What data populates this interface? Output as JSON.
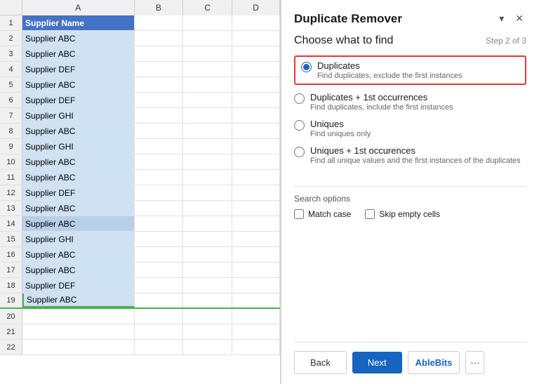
{
  "spreadsheet": {
    "columns": [
      "A",
      "B",
      "C",
      "D"
    ],
    "header_cell": "Supplier Name",
    "rows": [
      {
        "num": 1,
        "a": "Supplier Name",
        "is_header": true
      },
      {
        "num": 2,
        "a": "Supplier ABC",
        "selected": true
      },
      {
        "num": 3,
        "a": "Supplier ABC",
        "selected": true
      },
      {
        "num": 4,
        "a": "Supplier DEF",
        "selected": true
      },
      {
        "num": 5,
        "a": "Supplier ABC",
        "selected": true
      },
      {
        "num": 6,
        "a": "Supplier DEF",
        "selected": true
      },
      {
        "num": 7,
        "a": "Supplier GHI",
        "selected": true
      },
      {
        "num": 8,
        "a": "Supplier ABC",
        "selected": true
      },
      {
        "num": 9,
        "a": "Supplier GHI",
        "selected": true
      },
      {
        "num": 10,
        "a": "Supplier ABC",
        "selected": true
      },
      {
        "num": 11,
        "a": "Supplier ABC",
        "selected": true
      },
      {
        "num": 12,
        "a": "Supplier DEF",
        "selected": true
      },
      {
        "num": 13,
        "a": "Supplier ABC",
        "selected": true
      },
      {
        "num": 14,
        "a": "Supplier ABC",
        "selected": true,
        "alt": true
      },
      {
        "num": 15,
        "a": "Supplier GHI",
        "selected": true
      },
      {
        "num": 16,
        "a": "Supplier ABC",
        "selected": true
      },
      {
        "num": 17,
        "a": "Supplier ABC",
        "selected": true
      },
      {
        "num": 18,
        "a": "Supplier DEF",
        "selected": true
      },
      {
        "num": 19,
        "a": "Supplier ABC",
        "selected": true,
        "last_data": true
      },
      {
        "num": 20,
        "a": ""
      },
      {
        "num": 21,
        "a": ""
      },
      {
        "num": 22,
        "a": ""
      }
    ]
  },
  "panel": {
    "title": "Duplicate Remover",
    "section_title": "Choose what to find",
    "step": "Step 2 of 3",
    "options": [
      {
        "id": "opt_duplicates",
        "label": "Duplicates",
        "desc": "Find duplicates, exclude the first instances",
        "selected": true,
        "highlighted": true
      },
      {
        "id": "opt_dup_first",
        "label": "Duplicates + 1st occurrences",
        "desc": "Find duplicates, include the first instances",
        "selected": false,
        "highlighted": false
      },
      {
        "id": "opt_uniques",
        "label": "Uniques",
        "desc": "Find uniques only",
        "selected": false,
        "highlighted": false
      },
      {
        "id": "opt_uniques_first",
        "label": "Uniques + 1st occurences",
        "desc": "Find all unique values and the first instances of the duplicates",
        "selected": false,
        "highlighted": false
      }
    ],
    "search_options_label": "Search options",
    "checkboxes": [
      {
        "id": "match_case",
        "label": "Match case",
        "checked": false
      },
      {
        "id": "skip_empty",
        "label": "Skip empty cells",
        "checked": false
      }
    ],
    "buttons": {
      "back": "Back",
      "next": "Next",
      "ablebits": "AbleBits",
      "more": "···"
    }
  }
}
